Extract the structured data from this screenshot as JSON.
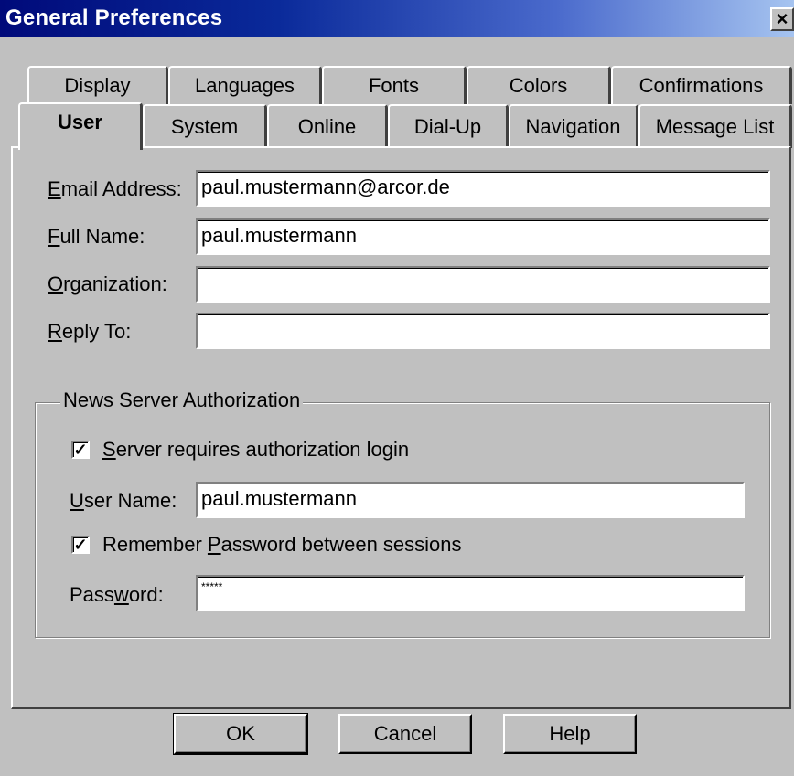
{
  "window": {
    "title": "General Preferences",
    "close_glyph": "×"
  },
  "tabs": {
    "row1": [
      "Display",
      "Languages",
      "Fonts",
      "Colors",
      "Confirmations"
    ],
    "row2": [
      "User",
      "System",
      "Online",
      "Dial-Up",
      "Navigation",
      "Message List"
    ],
    "active": "User"
  },
  "user": {
    "email_label_u": "E",
    "email_label_rest": "mail Address:",
    "email_value": "paul.mustermann@arcor.de",
    "fullname_label_u": "F",
    "fullname_label_rest": "ull Name:",
    "fullname_value": "paul.mustermann",
    "org_label_u": "O",
    "org_label_rest": "rganization:",
    "org_value": "",
    "reply_label_u": "R",
    "reply_label_rest": "eply To:",
    "reply_value": ""
  },
  "news_auth": {
    "group_title": "News Server Authorization",
    "check_glyph": "✓",
    "requires_login_u": "S",
    "requires_login_rest": "erver requires authorization login",
    "requires_login_checked": true,
    "username_label_u": "U",
    "username_label_rest": "ser Name:",
    "username_value": "paul.mustermann",
    "remember_pre": "Remember ",
    "remember_u": "P",
    "remember_rest": "assword between sessions",
    "remember_checked": true,
    "password_label_pre": "Pass",
    "password_label_u": "w",
    "password_label_rest": "ord:",
    "password_value": "*****"
  },
  "buttons": {
    "ok": "OK",
    "cancel": "Cancel",
    "help": "Help"
  }
}
